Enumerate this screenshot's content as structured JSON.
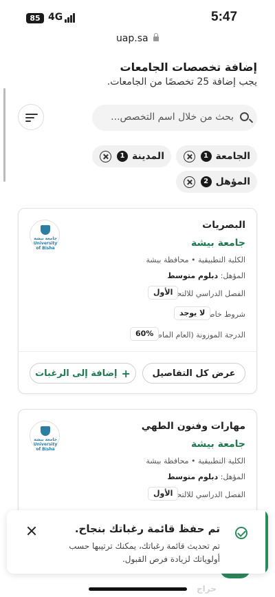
{
  "status_bar": {
    "battery": "85",
    "network": "4G",
    "time": "5:47"
  },
  "browser": {
    "url": "uap.sa"
  },
  "header": {
    "title": "إضافة تخصصات الجامعات",
    "subtitle": "يجب إضافة 25 تخصصًا من الجامعات."
  },
  "search": {
    "placeholder": "بحث من خلال اسم التخصص..."
  },
  "filters": [
    {
      "label": "الجامعة",
      "count": "1"
    },
    {
      "label": "المدينة",
      "count": "1"
    },
    {
      "label": "المؤهل",
      "count": "2"
    }
  ],
  "cards": [
    {
      "name": "البصريات",
      "university": "جامعة بيشة",
      "college": "الكلية التطبيقية • محافظة بيشة",
      "qualification_label": "المؤهل:",
      "qualification_value": "دبلوم متوسط",
      "semester_label": "الفصل الدراسي للالتحاق:",
      "semester_value": "الأول",
      "conditions_label": "شروط خاصة:",
      "conditions_value": "لا يوجد",
      "score_label": "الدرجة الموزونة (العام الماضي)",
      "score_value": "60%",
      "logo_text": "جامعة بيشة University of Bisha",
      "details_btn": "عرض كل التفاصيل",
      "fav_btn": "إضافة إلى الرغبات"
    },
    {
      "name": "مهارات وفنون الطهي",
      "university": "جامعة بيشة",
      "college": "الكلية التطبيقية • محافظة بيشة",
      "qualification_label": "المؤهل:",
      "qualification_value": "دبلوم متوسط",
      "semester_label": "الفصل الدراسي للالتحاق:",
      "semester_value": "الأول",
      "logo_text": "جامعة بيشة University of Bisha"
    }
  ],
  "toast": {
    "title": "تم حفظ قائمة رغباتك بنجاح.",
    "message": "تم تحديث قائمة رغباتك، يمكنك ترتيبها حسب أولوياتك لزيادة فرص القبول."
  },
  "watermark": "حراج",
  "colors": {
    "accent_green": "#1f7a4f",
    "toast_bar": "#2b8a5a"
  }
}
